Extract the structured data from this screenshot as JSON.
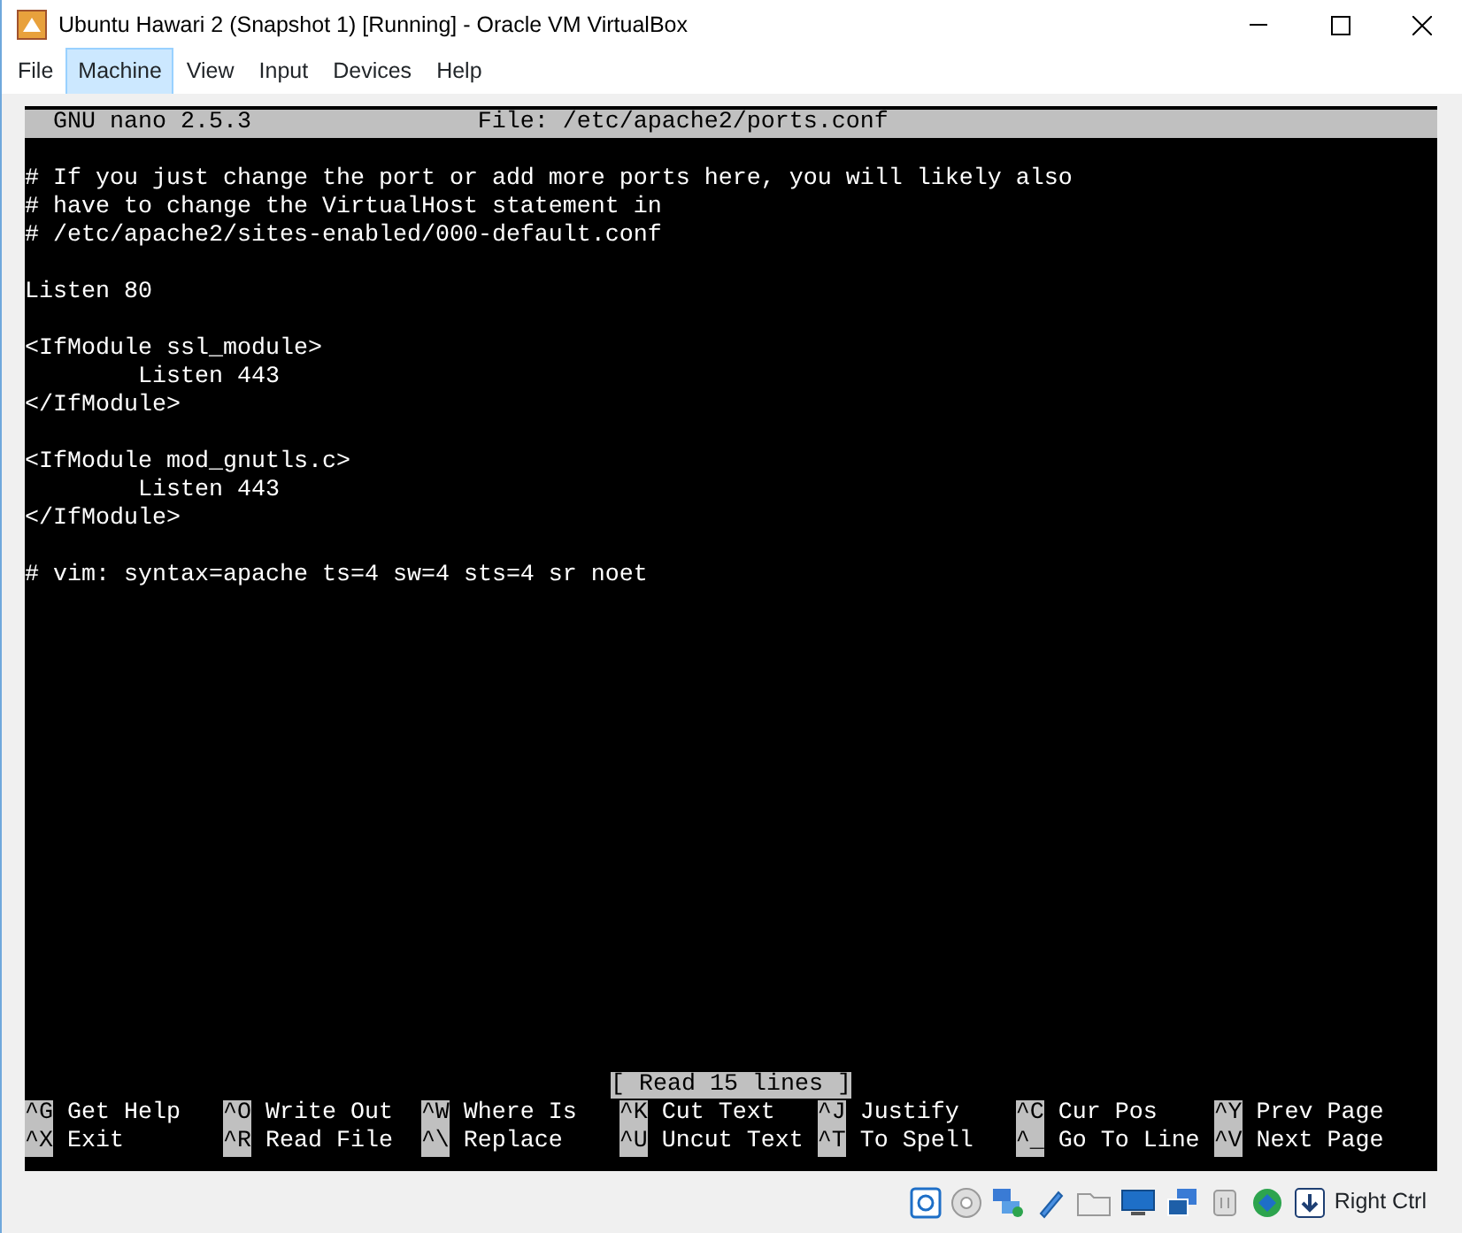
{
  "window": {
    "title": "Ubuntu Hawari 2 (Snapshot 1) [Running] - Oracle VM VirtualBox"
  },
  "menu": [
    {
      "label": "File",
      "selected": false
    },
    {
      "label": "Machine",
      "selected": true
    },
    {
      "label": "View",
      "selected": false
    },
    {
      "label": "Input",
      "selected": false
    },
    {
      "label": "Devices",
      "selected": false
    },
    {
      "label": "Help",
      "selected": false
    }
  ],
  "terminal": {
    "header": {
      "version": "GNU nano 2.5.3",
      "file": "File: /etc/apache2/ports.conf"
    },
    "paragraphs": [
      [
        {
          "text": "# If you just change the port or add more ports here, you will likely also",
          "indent": false
        },
        {
          "text": "# have to change the VirtualHost statement in",
          "indent": false
        },
        {
          "text": "# /etc/apache2/sites-enabled/000-default.conf",
          "indent": false
        }
      ],
      [
        {
          "text": "Listen 80",
          "indent": false
        }
      ],
      [
        {
          "text": "<IfModule ssl_module>",
          "indent": false
        },
        {
          "text": "Listen 443",
          "indent": true
        },
        {
          "text": "</IfModule>",
          "indent": false
        }
      ],
      [
        {
          "text": "<IfModule mod_gnutls.c>",
          "indent": false
        },
        {
          "text": "Listen 443",
          "indent": true
        },
        {
          "text": "</IfModule>",
          "indent": false
        }
      ],
      [
        {
          "text": "# vim: syntax=apache ts=4 sw=4 sts=4 sr noet",
          "indent": false
        }
      ]
    ],
    "status_message": "[ Read 15 lines ]",
    "shortcuts": [
      [
        {
          "key": "^G",
          "label": "Get Help"
        },
        {
          "key": "^O",
          "label": "Write Out"
        },
        {
          "key": "^W",
          "label": "Where Is"
        },
        {
          "key": "^K",
          "label": "Cut Text"
        },
        {
          "key": "^J",
          "label": "Justify"
        },
        {
          "key": "^C",
          "label": "Cur Pos"
        },
        {
          "key": "^Y",
          "label": "Prev Page"
        }
      ],
      [
        {
          "key": "^X",
          "label": "Exit"
        },
        {
          "key": "^R",
          "label": "Read File"
        },
        {
          "key": "^\\",
          "label": "Replace"
        },
        {
          "key": "^U",
          "label": "Uncut Text"
        },
        {
          "key": "^T",
          "label": "To Spell"
        },
        {
          "key": "^_",
          "label": "Go To Line"
        },
        {
          "key": "^V",
          "label": "Next Page"
        }
      ]
    ]
  },
  "status_bar": {
    "host_key": "Right Ctrl"
  }
}
